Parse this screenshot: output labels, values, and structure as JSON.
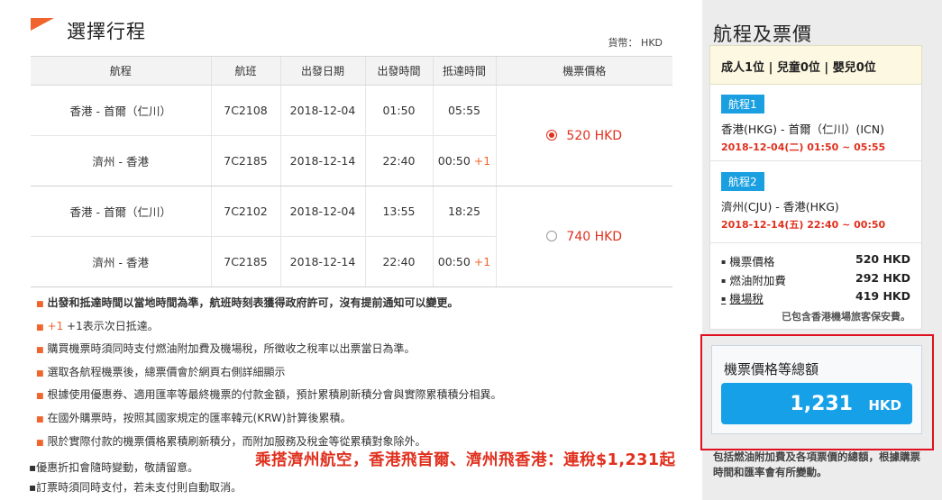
{
  "header": {
    "title": "選擇行程",
    "currency_label": "貨幣： HKD"
  },
  "table": {
    "columns": [
      "航程",
      "航班",
      "出發日期",
      "出發時間",
      "抵達時間",
      "機票價格"
    ],
    "options": [
      {
        "selected": true,
        "price": "520 HKD",
        "legs": [
          {
            "route": "香港 - 首爾（仁川）",
            "flight": "7C2108",
            "date": "2018-12-04",
            "depart": "01:50",
            "arrive": "05:55",
            "next_day": ""
          },
          {
            "route": "濟州 - 香港",
            "flight": "7C2185",
            "date": "2018-12-14",
            "depart": "22:40",
            "arrive": "00:50",
            "next_day": "+1"
          }
        ]
      },
      {
        "selected": false,
        "price": "740 HKD",
        "legs": [
          {
            "route": "香港 - 首爾（仁川）",
            "flight": "7C2102",
            "date": "2018-12-04",
            "depart": "13:55",
            "arrive": "18:25",
            "next_day": ""
          },
          {
            "route": "濟州 - 香港",
            "flight": "7C2185",
            "date": "2018-12-14",
            "depart": "22:40",
            "arrive": "00:50",
            "next_day": "+1"
          }
        ]
      }
    ]
  },
  "notes": {
    "n1": "出發和抵達時間以當地時間為準，航班時刻表獲得政府許可，沒有提前通知可以變更。",
    "n2_mark": "+1",
    "n2": "+1表示次日抵達。",
    "n3": "購買機票時須同時支付燃油附加費及機場稅，所徵收之稅率以出票當日為準。",
    "n4": "選取各航程機票後，總票價會於網頁右側詳細顯示",
    "n5": "根據使用優惠券、適用匯率等最終機票的付款金額，預計累積刷新積分會與實際累積積分相異。",
    "n6": "在國外購票時，按照其國家規定的匯率韓元(KRW)計算後累積。",
    "n7": "限於實際付款的機票價格累積刷新積分，而附加服務及稅金等從累積對象除外。",
    "n8": "優惠折扣會隨時變動，敬請留意。",
    "n9": "訂票時須同時支付，若未支付則自動取消。"
  },
  "promo_text": "乘搭濟州航空，香港飛首爾、濟州飛香港：連稅$1,231起",
  "sidebar": {
    "title": "航程及票價",
    "passengers": "成人1位 | 兒童0位 | 嬰兒0位",
    "segments": [
      {
        "tag": "航程1",
        "route": "香港(HKG) - 首爾（仁川）(ICN)",
        "time": "2018-12-04(二) 01:50 ~ 05:55"
      },
      {
        "tag": "航程2",
        "route": "濟州(CJU) - 香港(HKG)",
        "time": "2018-12-14(五) 22:40 ~ 00:50"
      }
    ],
    "fares": [
      {
        "label": "機票價格",
        "value": "520 HKD"
      },
      {
        "label": "燃油附加費",
        "value": "292 HKD"
      },
      {
        "label": "機場稅",
        "value": "419 HKD"
      }
    ],
    "fare_note": "已包含香港機場旅客保安費。",
    "total_label": "機票價格等總額",
    "total_amount": "1,231",
    "total_currency": "HKD",
    "footer": "包括燃油附加費及各項票價的總額，根據購票時間和匯率會有所變動。"
  },
  "colors": {
    "accent": "#f0652d",
    "price_red": "#e0301e",
    "blue": "#16a0e8",
    "highlight_frame": "#e0101e"
  }
}
